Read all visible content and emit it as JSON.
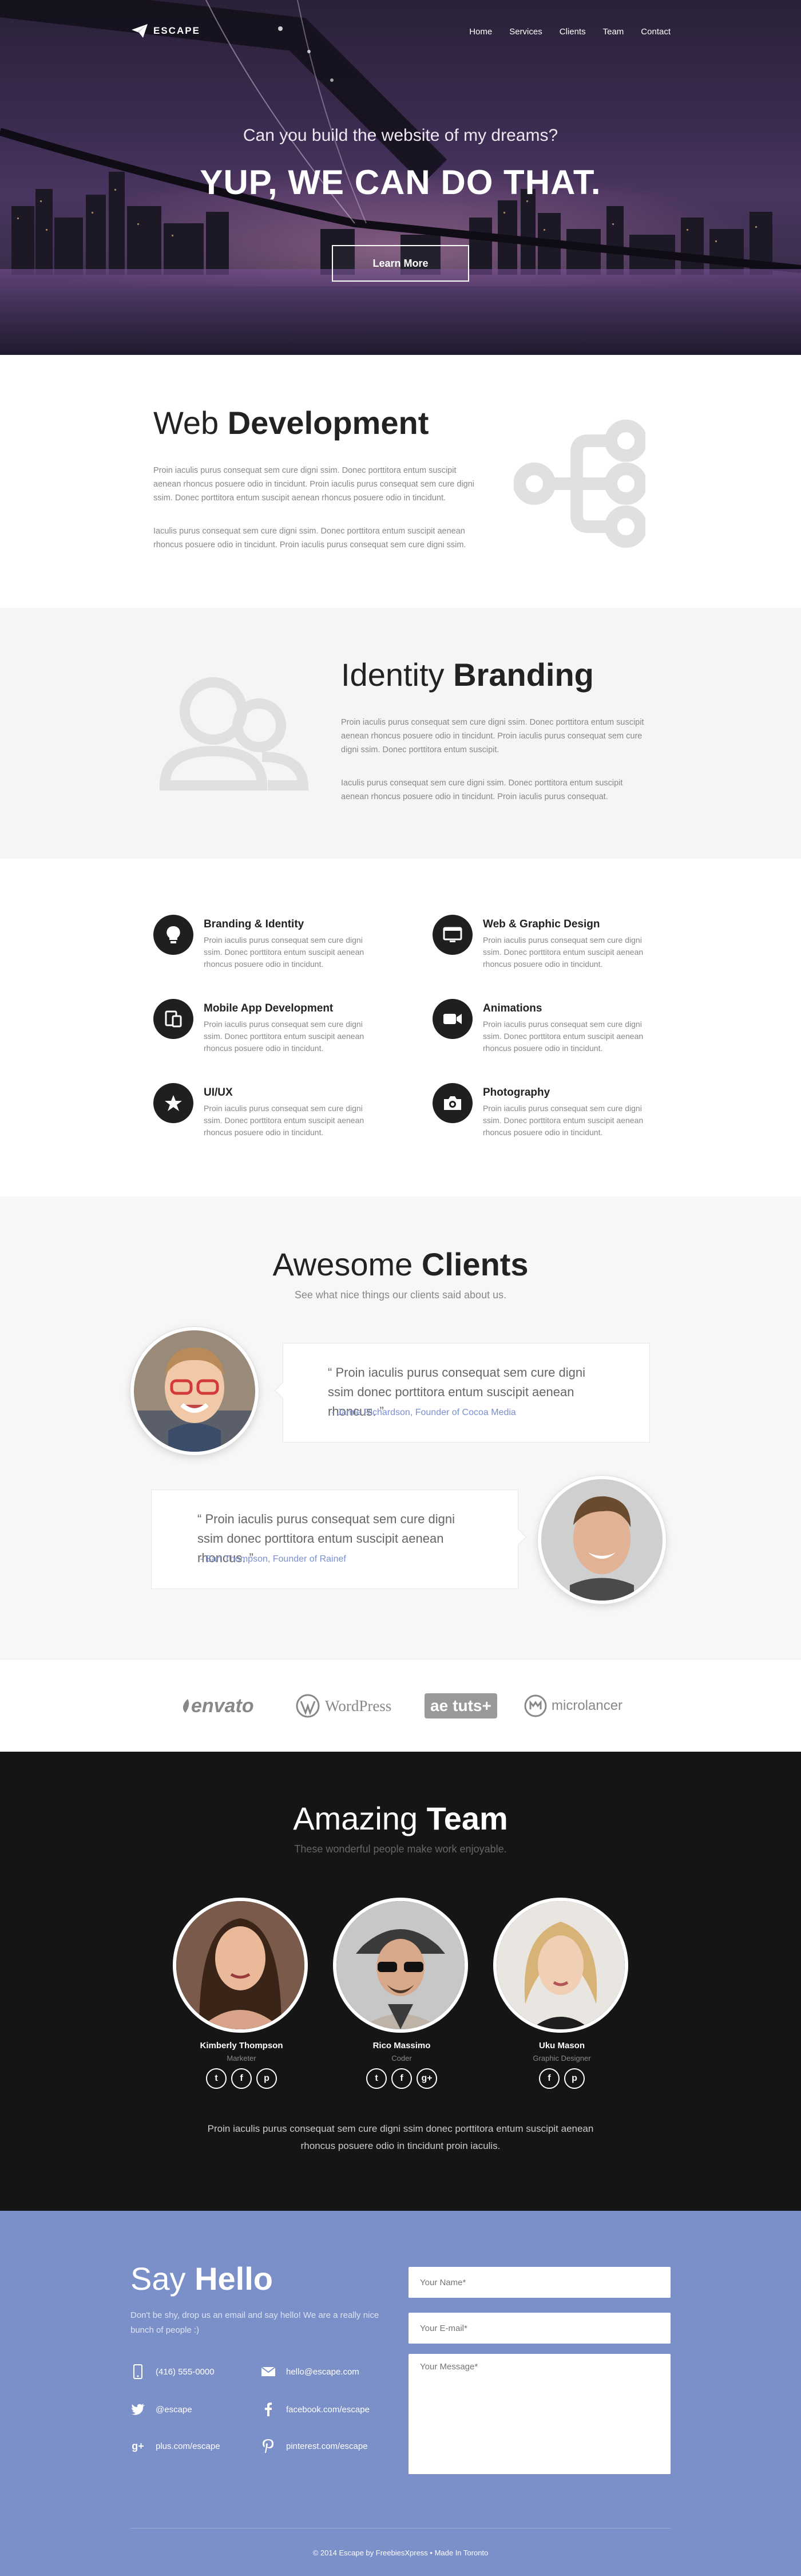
{
  "nav": {
    "logo": "ESCAPE",
    "items": [
      "Home",
      "Services",
      "Clients",
      "Team",
      "Contact"
    ]
  },
  "hero": {
    "subtitle": "Can you build the website of my dreams?",
    "headline": "YUP, WE CAN DO THAT.",
    "cta": "Learn More"
  },
  "webdev": {
    "title_light": "Web ",
    "title_bold": "Development",
    "p1": "Proin iaculis purus consequat sem cure digni ssim. Donec porttitora entum suscipit aenean rhoncus posuere odio in tincidunt. Proin iaculis purus consequat sem cure digni ssim. Donec porttitora entum suscipit aenean rhoncus posuere odio in tincidunt.",
    "p2": "Iaculis purus consequat sem cure digni ssim. Donec porttitora entum suscipit aenean rhoncus posuere odio in tincidunt. Proin iaculis purus consequat sem cure digni ssim.",
    "icon": "sitemap-icon"
  },
  "branding": {
    "title_light": "Identity ",
    "title_bold": "Branding",
    "p1": "Proin iaculis purus consequat sem cure digni ssim. Donec porttitora entum suscipit aenean rhoncus posuere odio in tincidunt. Proin iaculis purus consequat sem cure digni ssim. Donec porttitora entum suscipit.",
    "p2": "Iaculis purus consequat sem cure digni ssim. Donec porttitora entum suscipit aenean rhoncus posuere odio in tincidunt. Proin iaculis purus consequat.",
    "icon": "users-icon"
  },
  "services": [
    {
      "title": "Branding & Identity",
      "text": "Proin iaculis purus consequat sem cure digni ssim. Donec porttitora entum suscipit aenean rhoncus posuere odio in tincidunt.",
      "icon": "lightbulb-icon"
    },
    {
      "title": "Web & Graphic Design",
      "text": "Proin iaculis purus consequat sem cure digni ssim. Donec porttitora entum suscipit aenean rhoncus posuere odio in tincidunt.",
      "icon": "monitor-icon"
    },
    {
      "title": "Mobile App Development",
      "text": "Proin iaculis purus consequat sem cure digni ssim. Donec porttitora entum suscipit aenean rhoncus posuere odio in tincidunt.",
      "icon": "devices-icon"
    },
    {
      "title": "Animations",
      "text": "Proin iaculis purus consequat sem cure digni ssim. Donec porttitora entum suscipit aenean rhoncus posuere odio in tincidunt.",
      "icon": "video-camera-icon"
    },
    {
      "title": "UI/UX",
      "text": "Proin iaculis purus consequat sem cure digni ssim. Donec porttitora entum suscipit aenean rhoncus posuere odio in tincidunt.",
      "icon": "star-icon"
    },
    {
      "title": "Photography",
      "text": "Proin iaculis purus consequat sem cure digni ssim. Donec porttitora entum suscipit aenean rhoncus posuere odio in tincidunt.",
      "icon": "camera-icon"
    }
  ],
  "clients": {
    "title_light": "Awesome ",
    "title_bold": "Clients",
    "subtitle": "See what nice things our clients said about us.",
    "testimonials": [
      {
        "quote": "“ Proin iaculis purus consequat sem cure  digni ssim donec porttitora entum suscipit aenean rhoncus. ”",
        "author": "- Jamie Richardson, Founder of Cocoa Media"
      },
      {
        "quote": "“ Proin iaculis purus consequat sem cure  digni ssim donec porttitora entum suscipit aenean rhoncus. ”",
        "author": "- Bart Thompson, Founder of Rainef"
      }
    ]
  },
  "logos": {
    "envato": "envato",
    "wordpress": "WordPress",
    "tuts_ae": "ae",
    "tuts": "tuts+",
    "microlancer": "microlancer"
  },
  "team": {
    "title_light": "Amazing ",
    "title_bold": "Team",
    "subtitle": "These wonderful people make work enjoyable.",
    "members": [
      {
        "name": "Kimberly Thompson",
        "role": "Marketer",
        "social": [
          "t",
          "f",
          "p"
        ]
      },
      {
        "name": "Rico Massimo",
        "role": "Coder",
        "social": [
          "t",
          "f",
          "g+"
        ]
      },
      {
        "name": "Uku Mason",
        "role": "Graphic Designer",
        "social": [
          "f",
          "p"
        ]
      }
    ],
    "blurb": "Proin iaculis purus consequat sem cure  digni ssim donec porttitora entum suscipit aenean rhoncus posuere odio in tincidunt proin iaculis."
  },
  "contact": {
    "title_light": "Say ",
    "title_bold": "Hello",
    "intro": "Don't be shy, drop us an email and say hello! We are a really nice bunch of people :)",
    "phone": "(416) 555-0000",
    "email": "hello@escape.com",
    "twitter": "@escape",
    "facebook": "facebook.com/escape",
    "googleplus": "plus.com/escape",
    "pinterest": "pinterest.com/escape",
    "name_placeholder": "Your Name*",
    "email_placeholder": "Your E-mail*",
    "message_placeholder": "Your Message*",
    "copyright": "© 2014 Escape by FreebiesXpress • Made In Toronto"
  },
  "colors": {
    "accent": "#7b8fc8",
    "dark": "#151515",
    "link": "#7a8fcf"
  }
}
